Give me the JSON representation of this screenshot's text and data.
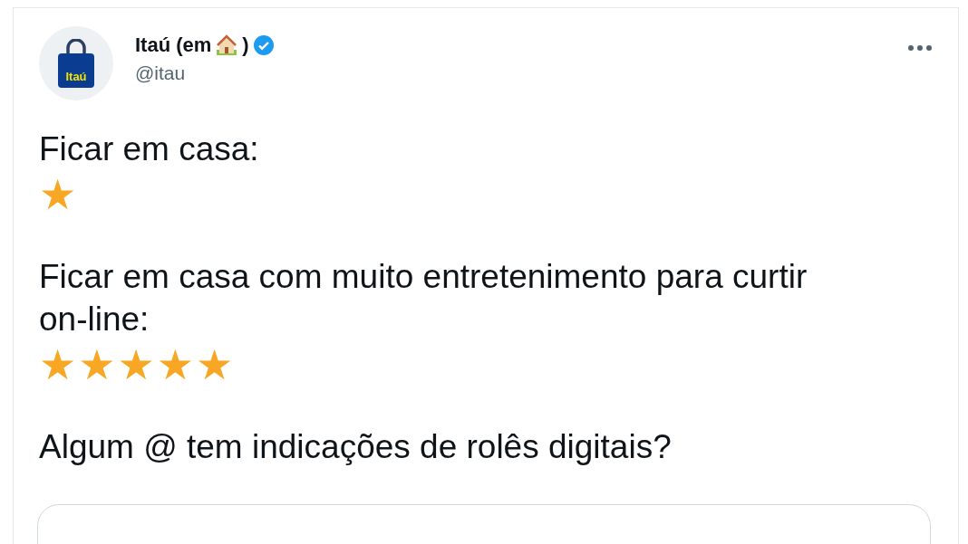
{
  "tweet": {
    "author": {
      "name": "Itaú (em",
      "name_end": ")",
      "verified": true,
      "handle": "@itau",
      "avatar_text": "Itaú"
    },
    "paragraphs": [
      {
        "text": "Ficar em casa:",
        "emoji": "★"
      },
      {
        "text": "Ficar em casa com muito entretenimento para curtir on-line:",
        "emoji": "★★★★★"
      },
      {
        "text": "Algum @ tem indicações de rolês digitais?"
      }
    ]
  }
}
